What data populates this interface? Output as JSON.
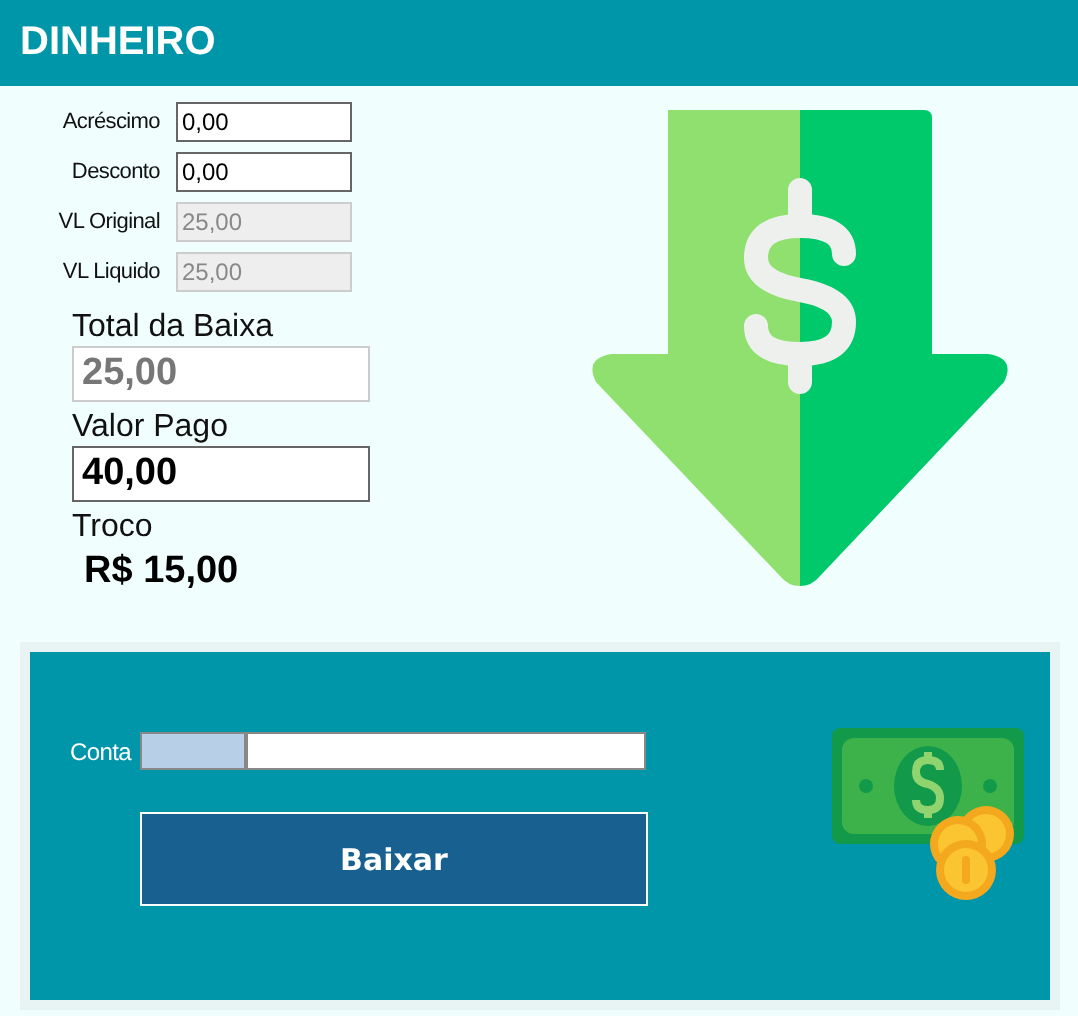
{
  "window": {
    "title": "DINHEIRO"
  },
  "fields": [
    {
      "label": "Acréscimo",
      "value": "0,00",
      "disabled": false
    },
    {
      "label": "Desconto",
      "value": "0,00",
      "disabled": false
    },
    {
      "label": "VL Original",
      "value": "25,00",
      "disabled": true
    },
    {
      "label": "VL Liquido",
      "value": "25,00",
      "disabled": true
    }
  ],
  "totals": [
    {
      "label": "Total da Baixa",
      "value": "25,00",
      "disabled": true
    },
    {
      "label": "Valor Pago",
      "value": "40,00",
      "disabled": false
    }
  ],
  "change": {
    "label": "Troco",
    "value": "R$ 15,00"
  },
  "account": {
    "label": "Conta"
  },
  "submit": {
    "label": "Baixar"
  }
}
